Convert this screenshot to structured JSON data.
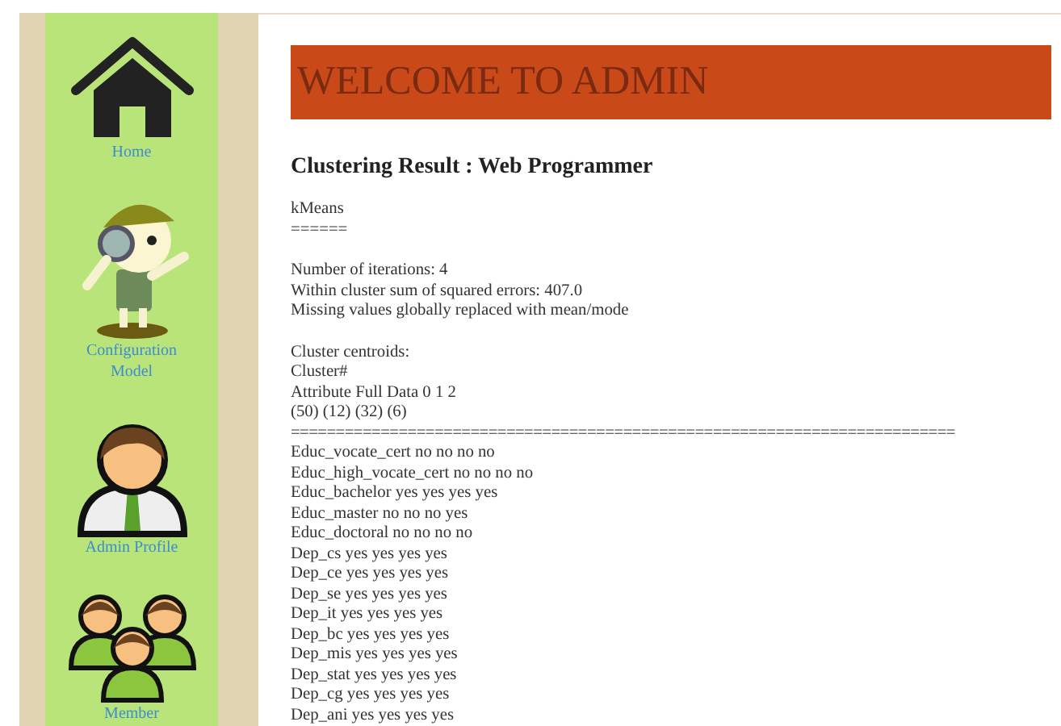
{
  "sidebar": {
    "items": [
      {
        "label": "Home",
        "kind": "house"
      },
      {
        "label": "Configuration Model",
        "kind": "explorer"
      },
      {
        "label": "Admin Profile",
        "kind": "person"
      },
      {
        "label": "Member",
        "kind": "group"
      }
    ]
  },
  "banner": {
    "title": "WELCOME TO ADMIN"
  },
  "heading": "Clustering Result : Web Programmer",
  "result": [
    [
      "kMeans",
      "======"
    ],
    [
      "Number of iterations: 4",
      "Within cluster sum of squared errors: 407.0",
      "Missing values globally replaced with mean/mode"
    ],
    [
      "Cluster centroids:",
      "Cluster#",
      "Attribute Full Data 0 1 2",
      "(50) (12) (32) (6)",
      "==========================================================================",
      "Educ_vocate_cert no no no no",
      "Educ_high_vocate_cert no no no no",
      "Educ_bachelor yes yes yes yes",
      "Educ_master no no no yes",
      "Educ_doctoral no no no no",
      "Dep_cs yes yes yes yes",
      "Dep_ce yes yes yes yes",
      "Dep_se yes yes yes yes",
      "Dep_it yes yes yes yes",
      "Dep_bc yes yes yes yes",
      "Dep_mis yes yes yes yes",
      "Dep_stat yes yes yes yes",
      "Dep_cg yes yes yes yes",
      "Dep_ani yes yes yes yes"
    ]
  ]
}
